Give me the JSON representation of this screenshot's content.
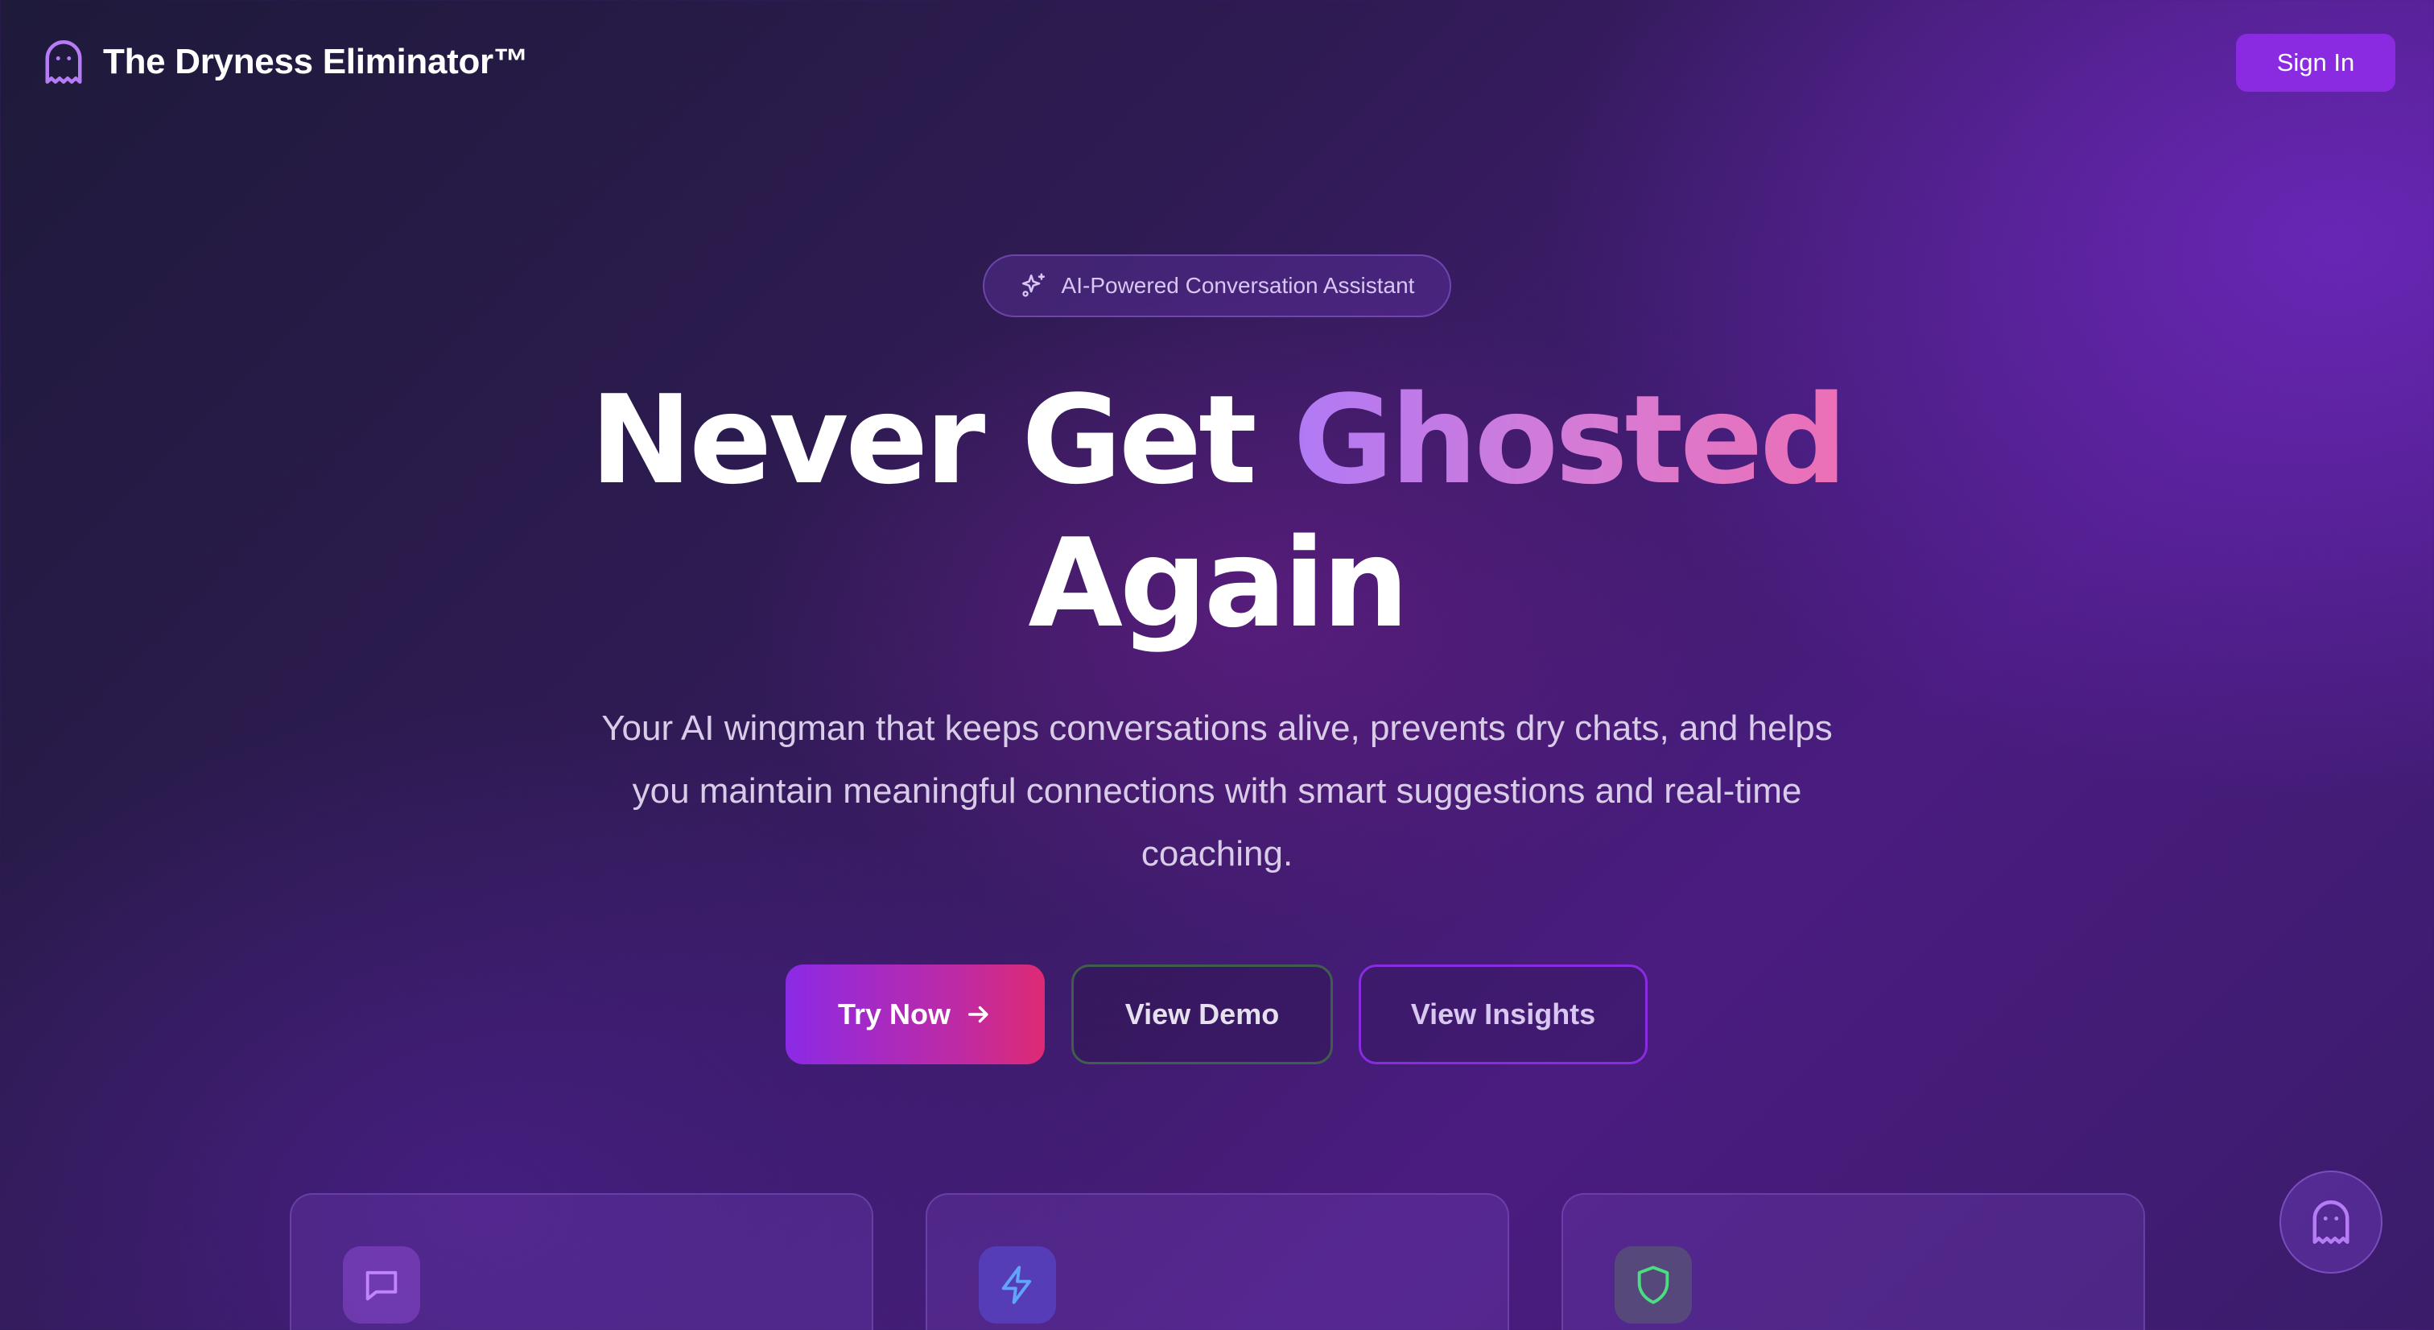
{
  "header": {
    "brand_title": "The Dryness Eliminator™",
    "brand_icon": "ghost-icon",
    "signin_label": "Sign In"
  },
  "hero": {
    "badge_icon": "sparkles-icon",
    "badge_text": "AI-Powered Conversation Assistant",
    "headline_part1": "Never Get ",
    "headline_accent": "Ghosted",
    "headline_part2": "Again",
    "subtitle": "Your AI wingman that keeps conversations alive, prevents dry chats, and helps you maintain meaningful connections with smart suggestions and real-time coaching."
  },
  "actions": {
    "try_now_label": "Try Now",
    "try_now_icon": "arrow-right-icon",
    "view_demo_label": "View Demo",
    "view_insights_label": "View Insights"
  },
  "features": [
    {
      "icon": "message-square-icon",
      "accent": "#c084fc"
    },
    {
      "icon": "zap-icon",
      "accent": "#60a5fa"
    },
    {
      "icon": "shield-icon",
      "accent": "#4ade80"
    }
  ],
  "floating_button": {
    "icon": "ghost-icon"
  },
  "colors": {
    "primary": "#8a2be2",
    "gradient_end": "#de2a74",
    "accent_text": "#d77bd4"
  }
}
